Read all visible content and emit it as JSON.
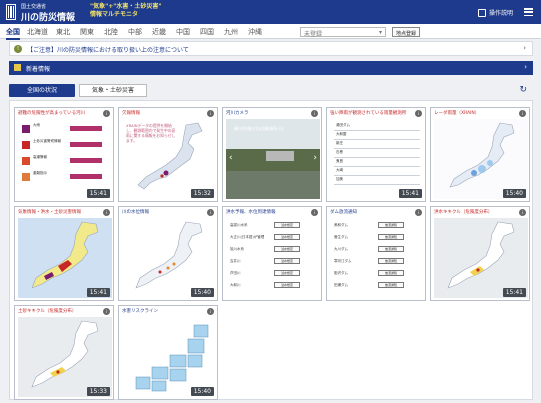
{
  "header": {
    "org": "国土交通省",
    "app_name": "川の防災情報",
    "tagline_line1": "\"気象\"+\"水害・土砂災害\"",
    "tagline_line2": "情報マルチモニタ",
    "help_label": "操作説明",
    "menu_icon": "hamburger-icon"
  },
  "regions": [
    "全国",
    "北海道",
    "東北",
    "関東",
    "北陸",
    "中部",
    "近畿",
    "中国",
    "四国",
    "九州",
    "沖縄"
  ],
  "region_select": {
    "value": "未登録"
  },
  "register_button": "地点登録",
  "notice": {
    "text": "【ご注意】川の防災情報における取り扱い上の注意について"
  },
  "news": {
    "text": "新着情報"
  },
  "view_tabs": {
    "status": "全国の状況",
    "weather": "気象・土砂災害"
  },
  "colors": {
    "brand": "#1d3a8c",
    "danger": "#c62828",
    "tagline": "#f2e36b"
  },
  "cards": [
    {
      "title": "避難の危険性が高まっている河川",
      "time": "15:41"
    },
    {
      "title": "欠報情報",
      "time": "15:32",
      "text": "XRAINデータの提供を開始し、観測範囲内で発生中の豪雨に関する情報をお知らせします。"
    },
    {
      "title": "河川カメラ",
      "camera_caption": "横川(利根川)水位観測所 (1)",
      "time": ""
    },
    {
      "title": "強い降雨が観測されている雨量観測所",
      "time": "15:41"
    },
    {
      "title": "レーダ雨量（XRAIN）",
      "time": "15:40"
    },
    {
      "title": "気象情報・洪水・土砂災害情報",
      "time": "15:41"
    },
    {
      "title": "川の水位情報",
      "time": "15:40"
    },
    {
      "title": "洪水予報、水位到達情報",
      "time": ""
    },
    {
      "title": "ダム放流通知",
      "time": ""
    },
    {
      "title": "洪水キキクル（危険度分布）",
      "time": "15:41"
    },
    {
      "title": "土砂キキクル（危険度分布）",
      "time": "15:33"
    },
    {
      "title": "水害リスクライン",
      "time": "15:40"
    }
  ],
  "levels": [
    "大雨",
    "土砂災害警戒情報",
    "高潮警報",
    "避難指示"
  ],
  "forecast_rows": [
    "高梁川水系",
    "大正川(日本語)が管理",
    "旭川水系",
    "吉井川",
    "芦田川",
    "大和川"
  ],
  "forecast_btn": "浸水想定",
  "dam_rows": [
    "美和ダム",
    "菅生ダム",
    "大川ダム",
    "寒河江ダム",
    "胆沢ダム",
    "田瀬ダム"
  ],
  "dam_btn": "放流通知",
  "rain_stations": [
    "湯田ダム",
    "大和屋",
    "新庄",
    "石巻",
    "鬼首",
    "大崎",
    "加美"
  ]
}
